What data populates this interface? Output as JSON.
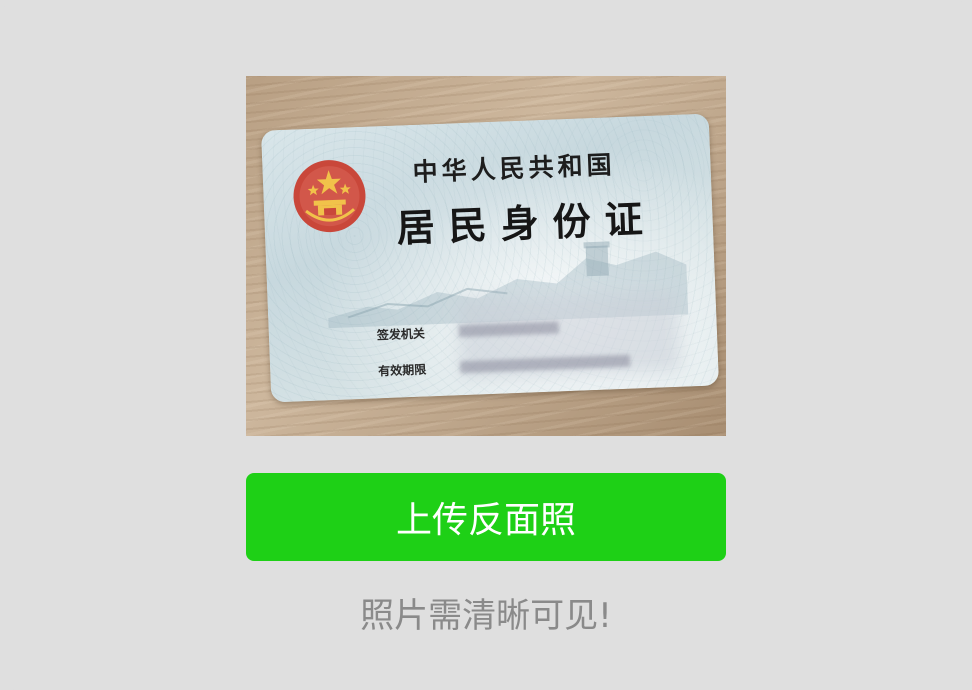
{
  "id_card_photo": {
    "title_line_1": "中华人民共和国",
    "title_line_2": "居民身份证",
    "field_issuing_authority_label": "签发机关",
    "field_validity_label": "有效期限"
  },
  "actions": {
    "upload_back_label": "上传反面照"
  },
  "hint_text": "照片需清晰可见!",
  "colors": {
    "button_green": "#1ed016",
    "hint_gray": "#8a8a8a",
    "background": "#dfdfdf"
  }
}
